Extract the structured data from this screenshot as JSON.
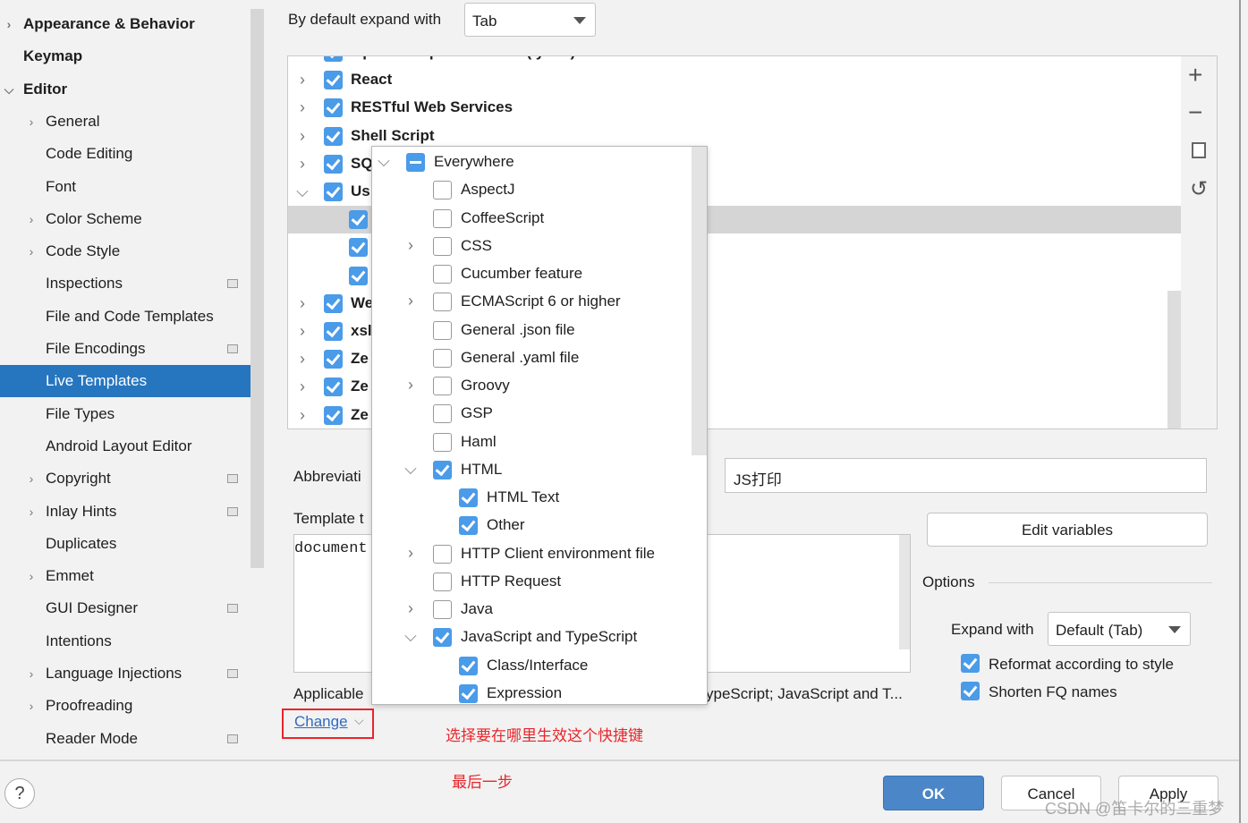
{
  "sidebar": {
    "items": [
      {
        "label": "Appearance & Behavior",
        "level": 0,
        "bold": true,
        "chevron": "right"
      },
      {
        "label": "Keymap",
        "level": 0,
        "bold": true
      },
      {
        "label": "Editor",
        "level": 0,
        "bold": true,
        "chevron": "down"
      },
      {
        "label": "General",
        "level": 1,
        "chevron": "right"
      },
      {
        "label": "Code Editing",
        "level": 1
      },
      {
        "label": "Font",
        "level": 1
      },
      {
        "label": "Color Scheme",
        "level": 1,
        "chevron": "right"
      },
      {
        "label": "Code Style",
        "level": 1,
        "chevron": "right"
      },
      {
        "label": "Inspections",
        "level": 1,
        "settings_icon": true
      },
      {
        "label": "File and Code Templates",
        "level": 1
      },
      {
        "label": "File Encodings",
        "level": 1,
        "settings_icon": true
      },
      {
        "label": "Live Templates",
        "level": 1,
        "selected": true
      },
      {
        "label": "File Types",
        "level": 1
      },
      {
        "label": "Android Layout Editor",
        "level": 1
      },
      {
        "label": "Copyright",
        "level": 1,
        "chevron": "right",
        "settings_icon": true
      },
      {
        "label": "Inlay Hints",
        "level": 1,
        "chevron": "right",
        "settings_icon": true
      },
      {
        "label": "Duplicates",
        "level": 1
      },
      {
        "label": "Emmet",
        "level": 1,
        "chevron": "right"
      },
      {
        "label": "GUI Designer",
        "level": 1,
        "settings_icon": true
      },
      {
        "label": "Intentions",
        "level": 1
      },
      {
        "label": "Language Injections",
        "level": 1,
        "chevron": "right",
        "settings_icon": true
      },
      {
        "label": "Proofreading",
        "level": 1,
        "chevron": "right"
      },
      {
        "label": "Reader Mode",
        "level": 1,
        "settings_icon": true
      }
    ]
  },
  "header": {
    "expand_label": "By default expand with",
    "expand_value": "Tab"
  },
  "tree": {
    "rows": [
      {
        "label": "OpenAPI Specifications (.yaml)",
        "chevron": "right",
        "level": 0
      },
      {
        "label": "React",
        "chevron": "right",
        "level": 0
      },
      {
        "label": "RESTful Web Services",
        "chevron": "right",
        "level": 0
      },
      {
        "label": "Shell Script",
        "chevron": "right",
        "level": 0
      },
      {
        "label": "SQ",
        "chevron": "right",
        "level": 0
      },
      {
        "label": "Us",
        "chevron": "down",
        "level": 0
      },
      {
        "label": "",
        "level": 1,
        "selected": true
      },
      {
        "label": "",
        "level": 1
      },
      {
        "label": "",
        "level": 1
      },
      {
        "label": "We",
        "chevron": "right",
        "level": 0
      },
      {
        "label": "xsl",
        "chevron": "right",
        "level": 0
      },
      {
        "label": "Ze",
        "chevron": "right",
        "level": 0
      },
      {
        "label": "Ze",
        "chevron": "right",
        "level": 0
      },
      {
        "label": "Ze",
        "chevron": "right",
        "level": 0
      }
    ]
  },
  "toolbar": {
    "add": "+",
    "remove": "−",
    "copy": "copy",
    "restore": "↺"
  },
  "popup": {
    "rows": [
      {
        "label": "Everywhere",
        "state": "mixed",
        "chevron": "down",
        "level": 0
      },
      {
        "label": "AspectJ",
        "state": "off",
        "level": 1
      },
      {
        "label": "CoffeeScript",
        "state": "off",
        "level": 1
      },
      {
        "label": "CSS",
        "state": "off",
        "level": 1,
        "chevron": "right"
      },
      {
        "label": "Cucumber feature",
        "state": "off",
        "level": 1
      },
      {
        "label": "ECMAScript 6 or higher",
        "state": "off",
        "level": 1,
        "chevron": "right"
      },
      {
        "label": "General .json file",
        "state": "off",
        "level": 1
      },
      {
        "label": "General .yaml file",
        "state": "off",
        "level": 1
      },
      {
        "label": "Groovy",
        "state": "off",
        "level": 1,
        "chevron": "right"
      },
      {
        "label": "GSP",
        "state": "off",
        "level": 1
      },
      {
        "label": "Haml",
        "state": "off",
        "level": 1
      },
      {
        "label": "HTML",
        "state": "on",
        "level": 1,
        "chevron": "down"
      },
      {
        "label": "HTML Text",
        "state": "on",
        "level": 2
      },
      {
        "label": "Other",
        "state": "on",
        "level": 2
      },
      {
        "label": "HTTP Client environment file",
        "state": "off",
        "level": 1,
        "chevron": "right"
      },
      {
        "label": "HTTP Request",
        "state": "off",
        "level": 1
      },
      {
        "label": "Java",
        "state": "off",
        "level": 1,
        "chevron": "right"
      },
      {
        "label": "JavaScript and TypeScript",
        "state": "on",
        "level": 1,
        "chevron": "down"
      },
      {
        "label": "Class/Interface",
        "state": "on",
        "level": 2
      },
      {
        "label": "Expression",
        "state": "on",
        "level": 2
      }
    ]
  },
  "editor": {
    "abbreviation_label": "Abbreviati",
    "description_value": "JS打印",
    "template_label": "Template t",
    "template_text": "document",
    "applicable_label": "Applicable",
    "applicable_value": "ypeScript; JavaScript and T...",
    "change_link": "Change"
  },
  "options": {
    "edit_variables": "Edit variables",
    "title": "Options",
    "expand_with_label": "Expand with",
    "expand_with_value": "Default (Tab)",
    "reformat": "Reformat according to style",
    "shorten": "Shorten FQ names"
  },
  "annotations": {
    "choose_where": "选择要在哪里生效这个快捷键",
    "last_step": "最后一步",
    "color": "#e8262b"
  },
  "footer": {
    "help": "?",
    "ok": "OK",
    "cancel": "Cancel",
    "apply": "Apply"
  },
  "watermark": "CSDN @笛卡尔的三重梦",
  "colors": {
    "accent": "#2675bf",
    "checkbox": "#4a9be8",
    "ok_button": "#4a86c8"
  }
}
